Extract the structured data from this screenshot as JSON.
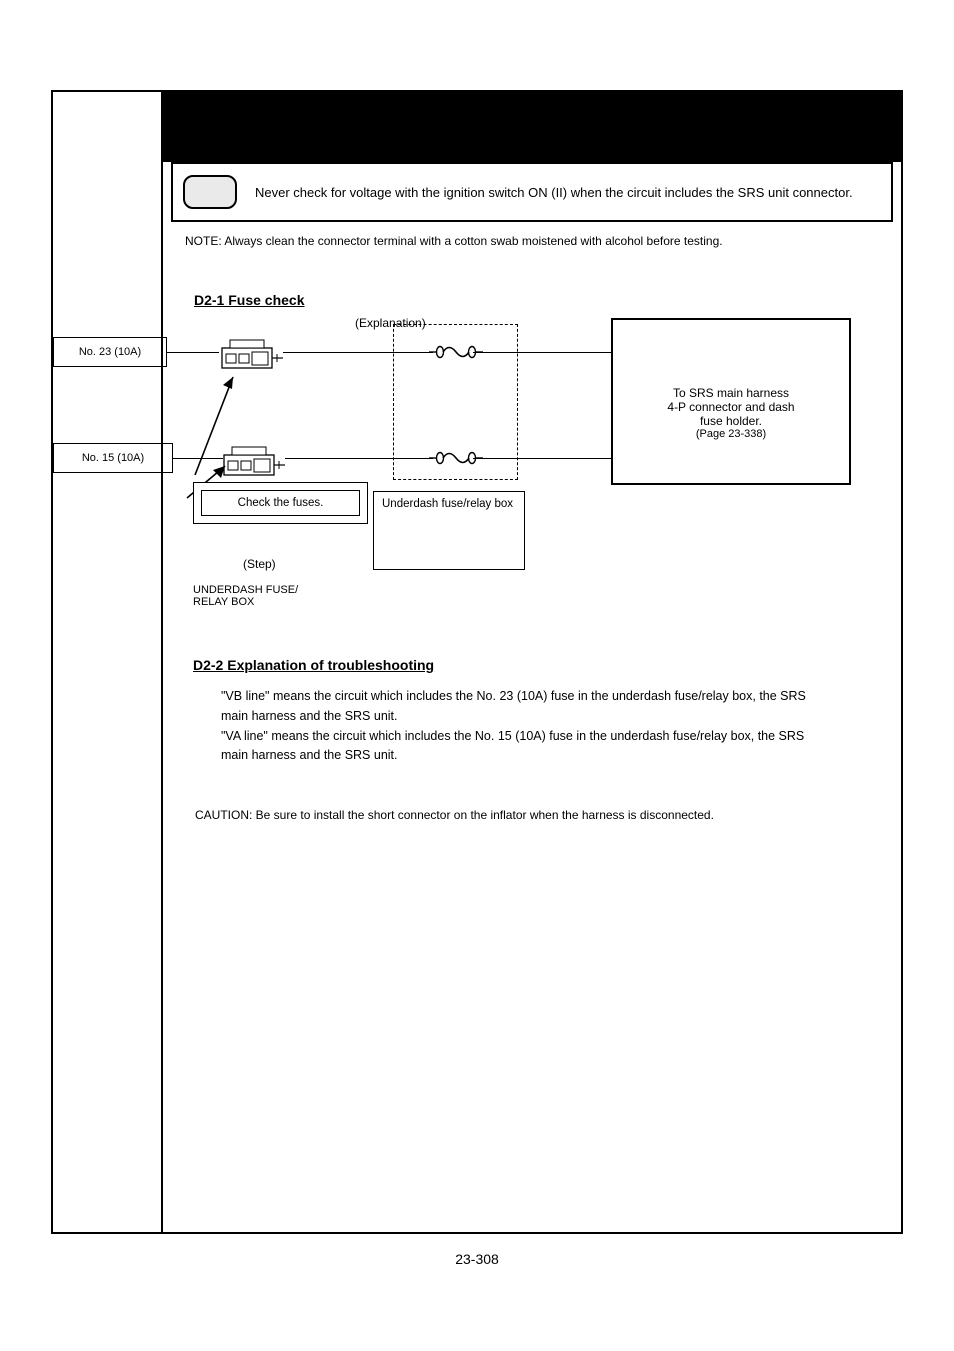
{
  "banner": {
    "title": ""
  },
  "notice": {
    "text": "Never check for voltage with the ignition switch ON (II) when the circuit includes the SRS unit connector."
  },
  "note": "NOTE: Always clean the connector terminal with a cotton swab moistened with alcohol before testing.",
  "d2_1": {
    "heading": "D2-1 Fuse check",
    "tab1": "No. 23 (10A)",
    "tab2": "No. 15 (10A)",
    "hint_box": "Underdash fuse/relay box",
    "junction_line1": "To SRS main harness",
    "junction_line2": "4-P connector and dash",
    "junction_line3": "fuse holder.",
    "junction_small": "(Page 23-338)",
    "step_title": "Check the fuses.",
    "arrow_caption_line1": "UNDERDASH FUSE/",
    "arrow_caption_line2": "RELAY BOX"
  },
  "d2_2": {
    "heading": "D2-2 Explanation of troubleshooting",
    "line1": "\"VB line\" means the circuit which includes the No. 23 (10A) fuse in the underdash fuse/relay box, the SRS",
    "line2": "main harness and the SRS unit.",
    "line3": "\"VA line\" means the circuit which includes the No. 15 (10A) fuse in the underdash fuse/relay box, the SRS",
    "line4": "main harness and the SRS unit."
  },
  "caution": "CAUTION: Be sure to install the short connector on the inflator when the harness is disconnected.",
  "footer": "23-308"
}
